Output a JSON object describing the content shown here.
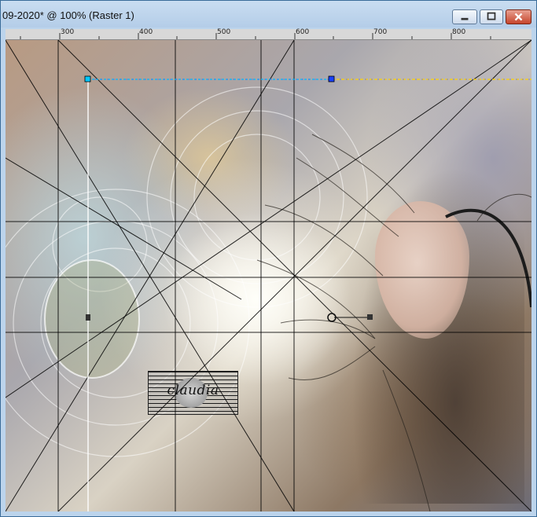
{
  "window": {
    "title": "09-2020* @ 100% (Raster 1)",
    "controls": {
      "minimize": "minimize-icon",
      "maximize": "maximize-icon",
      "close": "close-icon"
    }
  },
  "ruler": {
    "labels": [
      "300",
      "400",
      "500",
      "600",
      "700",
      "800"
    ]
  },
  "canvas": {
    "watermark_text": "claudia",
    "handle_color": "#00c8ff",
    "dashed_line_colors": [
      "#3a4bff",
      "#ffd200"
    ]
  },
  "colors": {
    "titlebar": "#bcd4ec",
    "close_button": "#c6452c",
    "frame": "#6fa6d6"
  }
}
